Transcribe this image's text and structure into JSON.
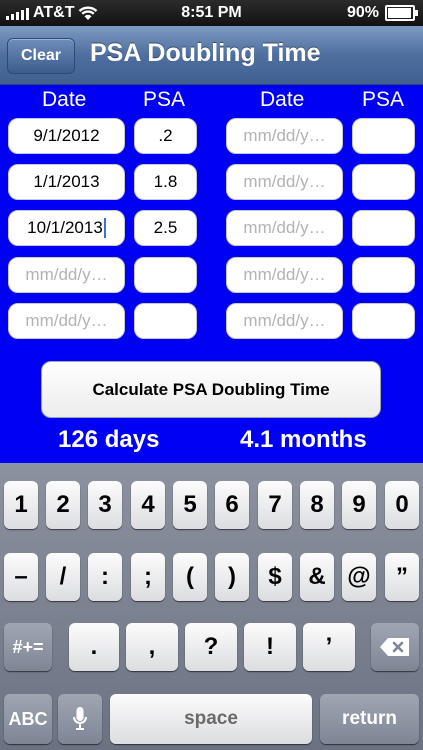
{
  "status_bar": {
    "carrier": "AT&T",
    "time": "8:51 PM",
    "battery": "90%",
    "battery_level": 0.9
  },
  "navbar": {
    "clear_label": "Clear",
    "title": "PSA Doubling Time"
  },
  "form": {
    "headers": {
      "date": "Date",
      "psa": "PSA"
    },
    "rows_left": [
      {
        "date": "9/1/2012",
        "psa": ".2"
      },
      {
        "date": "1/1/2013",
        "psa": "1.8"
      },
      {
        "date": "10/1/2013",
        "psa": "2.5"
      },
      {
        "date": "",
        "psa": ""
      },
      {
        "date": "",
        "psa": ""
      }
    ],
    "date_placeholder": "mm/dd/y…",
    "calculate_label": "Calculate PSA Doubling Time",
    "result_days": "126 days",
    "result_months": "4.1 months"
  },
  "keyboard": {
    "row1": [
      "1",
      "2",
      "3",
      "4",
      "5",
      "6",
      "7",
      "8",
      "9",
      "0"
    ],
    "row2": [
      "–",
      "/",
      ":",
      ";",
      "(",
      ")",
      "$",
      "&",
      "@",
      "”"
    ],
    "row3": [
      ".",
      ",",
      "?",
      "!",
      "’"
    ],
    "shift_label": "#+=",
    "abc_label": "ABC",
    "space_label": "space",
    "return_label": "return"
  }
}
